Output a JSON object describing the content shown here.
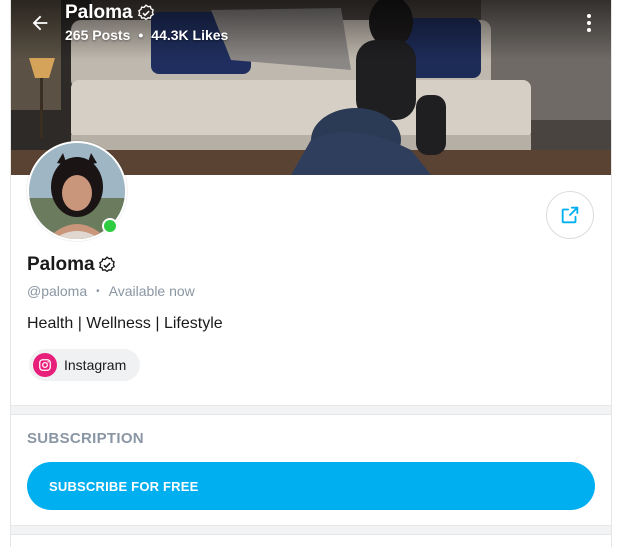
{
  "header": {
    "name": "Paloma",
    "posts": "265 Posts",
    "likes": "44.3K Likes",
    "separator": "•"
  },
  "profile": {
    "name": "Paloma",
    "handle": "@paloma",
    "separator": "•",
    "status": "Available now",
    "online": true,
    "bio": "Health | Wellness | Lifestyle"
  },
  "links": [
    {
      "label": "Instagram",
      "icon": "instagram-icon",
      "color": "#e81f7a"
    }
  ],
  "subscription": {
    "title": "SUBSCRIPTION",
    "button_label": "SUBSCRIBE FOR FREE",
    "accent": "#00aff0"
  },
  "colors": {
    "accent": "#00aff0",
    "online": "#2ecc40",
    "muted_text": "#8a96a3"
  }
}
